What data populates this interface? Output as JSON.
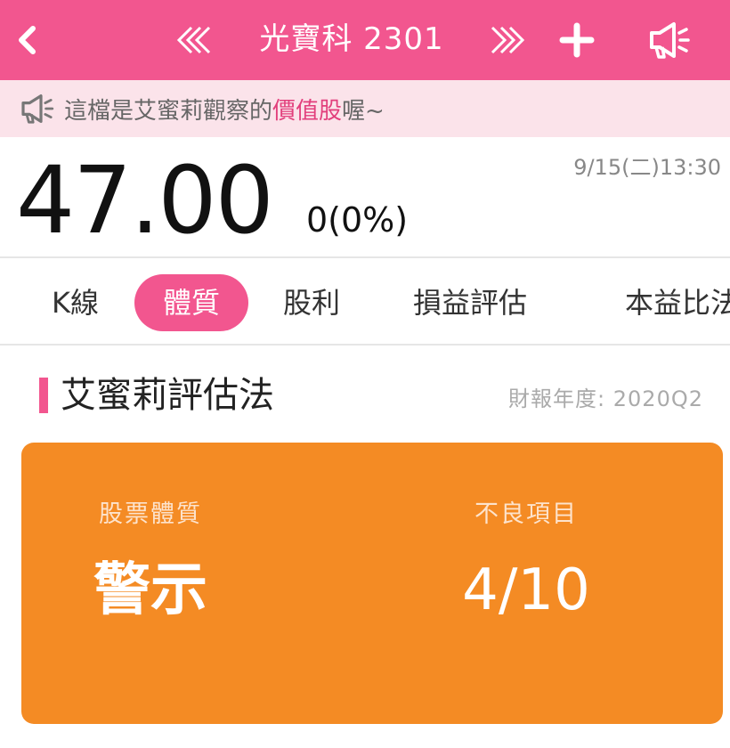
{
  "header": {
    "title": "光寶科 2301",
    "icons": {
      "back": "chevron-left-icon",
      "prev": "double-chevron-left-icon",
      "next": "double-chevron-right-icon",
      "add": "plus-icon",
      "speaker": "megaphone-icon"
    },
    "color": "#f2568f"
  },
  "notice": {
    "prefix": "這檔是艾蜜莉觀察的",
    "highlight": "價值股",
    "suffix": "喔~"
  },
  "quote": {
    "price": "47.00",
    "change": "0(0%)",
    "timestamp": "9/15(二)13:30"
  },
  "tabs": [
    {
      "label": "K線"
    },
    {
      "label": "體質",
      "active": true
    },
    {
      "label": "股利"
    },
    {
      "label": "損益評估"
    },
    {
      "label": "本益比法"
    }
  ],
  "section": {
    "title": "艾蜜莉評估法",
    "report_period": "財報年度: 2020Q2"
  },
  "summary_card": {
    "color": "#f48b24",
    "health_label": "股票體質",
    "health_value": "警示",
    "bad_items_label": "不良項目",
    "bad_items_value": "4/10"
  }
}
